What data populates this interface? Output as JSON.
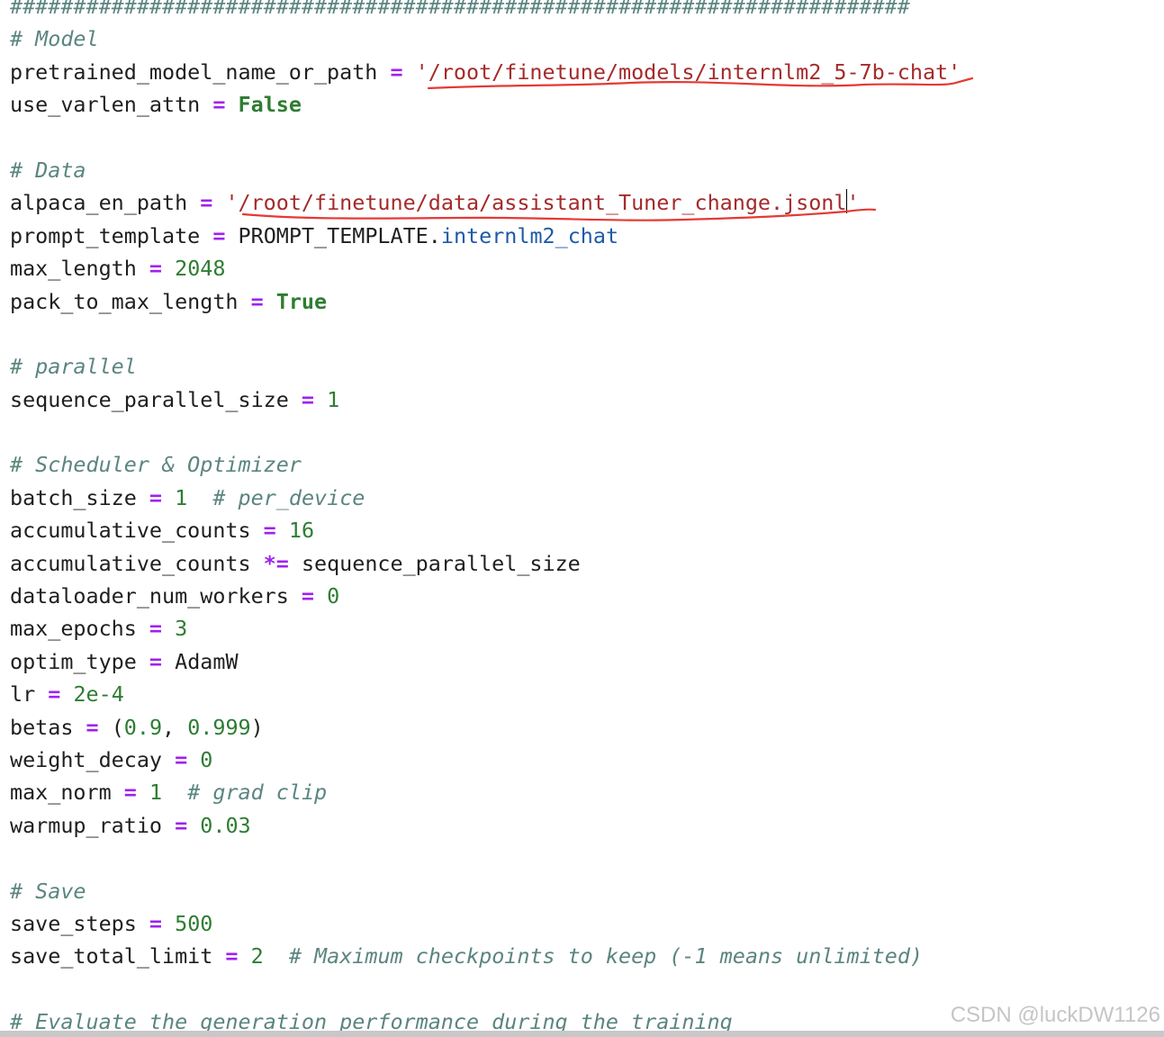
{
  "editor": {
    "lines": {
      "hash_rule": "#######################################################################",
      "model_comment": "# Model",
      "pretrained_name": "pretrained_model_name_or_path",
      "pretrained_value": "'/root/finetune/models/internlm2_5-7b-chat'",
      "varlen_name": "use_varlen_attn",
      "varlen_value": "False",
      "data_comment": "# Data",
      "alpaca_name": "alpaca_en_path",
      "alpaca_value_a": "'/root/finetune/data/assistant_Tuner_change.jsonl",
      "alpaca_value_b": "'",
      "prompt_name": "prompt_template",
      "prompt_obj": "PROMPT_TEMPLATE",
      "prompt_dot": ".",
      "prompt_attr": "internlm2_chat",
      "maxlen_name": "max_length",
      "maxlen_value": "2048",
      "pack_name": "pack_to_max_length",
      "pack_value": "True",
      "parallel_comment": "# parallel",
      "seqpar_name": "sequence_parallel_size",
      "seqpar_value": "1",
      "sched_comment": "# Scheduler & Optimizer",
      "batch_name": "batch_size",
      "batch_value": "1",
      "batch_comment": "# per_device",
      "accum_name": "accumulative_counts",
      "accum_value": "16",
      "accum2_name": "accumulative_counts",
      "accum2_op": "*=",
      "accum2_value": "sequence_parallel_size",
      "dl_name": "dataloader_num_workers",
      "dl_value": "0",
      "epochs_name": "max_epochs",
      "epochs_value": "3",
      "optim_name": "optim_type",
      "optim_value": "AdamW",
      "lr_name": "lr",
      "lr_value": "2e-4",
      "betas_name": "betas",
      "betas_open": "(",
      "betas_v1": "0.9",
      "betas_sep": ", ",
      "betas_v2": "0.999",
      "betas_close": ")",
      "wd_name": "weight_decay",
      "wd_value": "0",
      "maxnorm_name": "max_norm",
      "maxnorm_value": "1",
      "maxnorm_comment": "# grad clip",
      "warmup_name": "warmup_ratio",
      "warmup_value": "0.03",
      "save_comment": "# Save",
      "savesteps_name": "save_steps",
      "savesteps_value": "500",
      "savelimit_name": "save_total_limit",
      "savelimit_value": "2",
      "savelimit_comment": "# Maximum checkpoints to keep (-1 means unlimited)",
      "eval_comment": "# Evaluate the generation performance during the training"
    },
    "assign_op": "="
  },
  "watermark": "CSDN @luckDW1126",
  "colors": {
    "comment": "#5b8580",
    "string": "#a52a2a",
    "operator": "#a020f0",
    "number": "#2e7d32",
    "keyword": "#2e7d32",
    "attribute": "#1e5aa8",
    "annotation_underline": "#e53935"
  }
}
